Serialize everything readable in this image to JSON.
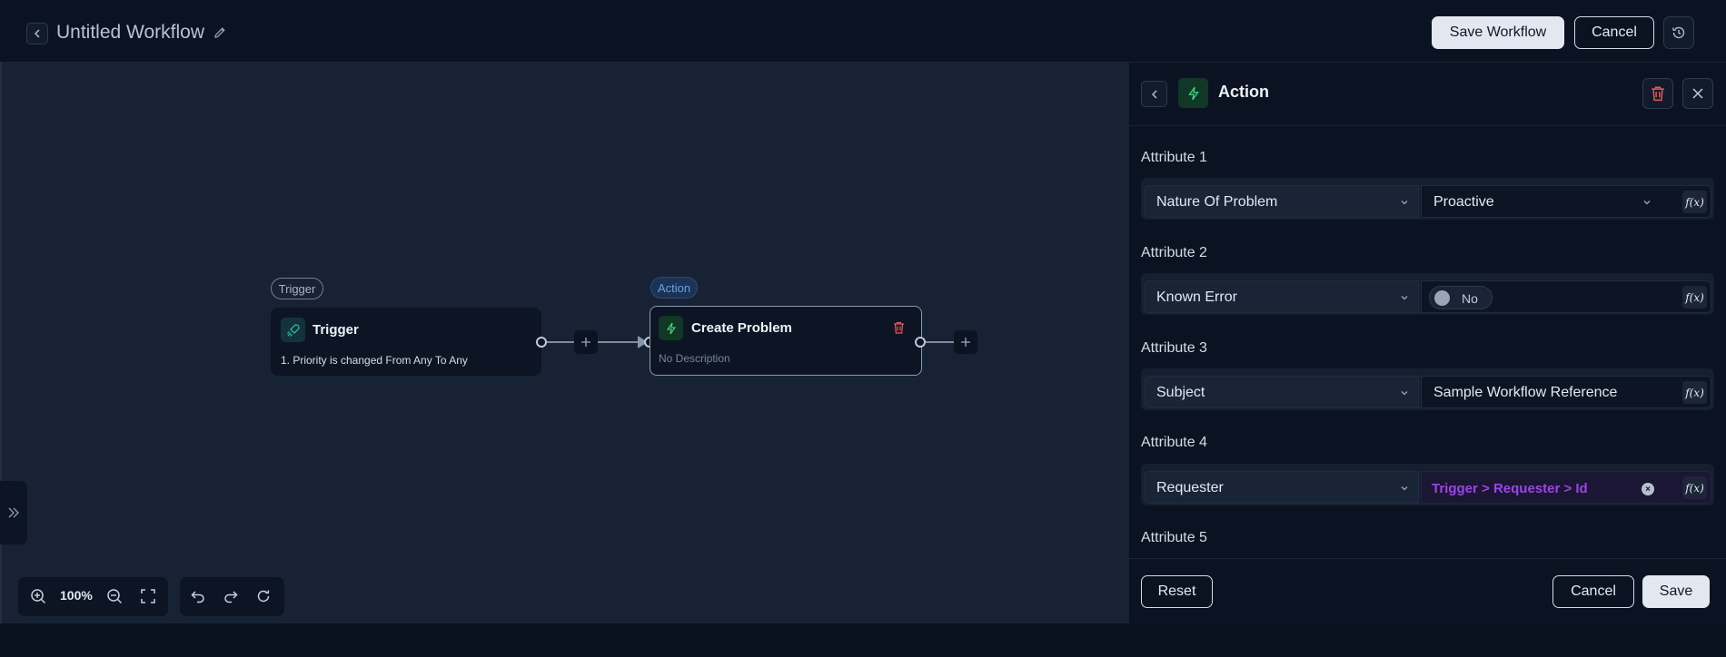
{
  "header": {
    "title": "Untitled Workflow",
    "save_workflow_label": "Save Workflow",
    "cancel_label": "Cancel"
  },
  "canvas": {
    "trigger_node": {
      "tag": "Trigger",
      "title": "Trigger",
      "description": "1. Priority is changed From Any To Any"
    },
    "action_node": {
      "tag": "Action",
      "title": "Create Problem",
      "description": "No Description"
    },
    "zoom_level": "100%"
  },
  "panel": {
    "title": "Action",
    "attributes": [
      {
        "label": "Attribute 1",
        "field": "Nature Of Problem",
        "value": "Proactive"
      },
      {
        "label": "Attribute 2",
        "field": "Known Error",
        "value": "No"
      },
      {
        "label": "Attribute 3",
        "field": "Subject",
        "value": "Sample Workflow Reference"
      },
      {
        "label": "Attribute 4",
        "field": "Requester",
        "value": "Trigger > Requester > Id"
      },
      {
        "label": "Attribute 5"
      }
    ],
    "fx_label": "f(x)",
    "reset_label": "Reset",
    "cancel_label": "Cancel",
    "save_label": "Save"
  }
}
